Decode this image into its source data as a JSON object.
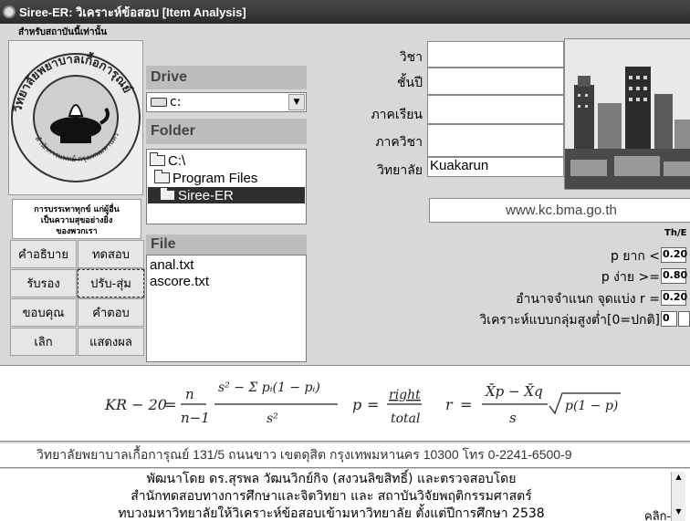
{
  "window": {
    "title": "Siree-ER: วิเคราะห์ข้อสอบ [Item Analysis]"
  },
  "logo": {
    "note": "สำหรับสถาบันนี้เท่านั้น",
    "ring_text": "วิทยาลัยพยาบาลเกื้อการุณย์",
    "bottom_text": "สำนักการแพทย์ กรุงเทพมหานคร"
  },
  "motto": [
    "การบรรเทาทุกข์ แก่ผู้อื่น",
    "เป็นความสุขอย่างยิ่ง",
    "ของพวกเรา"
  ],
  "buttons": {
    "explain": "คำอธิบาย",
    "test": "ทดสอบ",
    "certify": "รับรอง",
    "adjust": "ปรับ-สุ่ม",
    "thanks": "ขอบคุณ",
    "answer": "คำตอบ",
    "quit": "เลิก",
    "show": "แสดงผล"
  },
  "drive": {
    "header": "Drive",
    "value": "c:"
  },
  "folder": {
    "header": "Folder",
    "items": [
      "C:\\",
      "Program Files",
      "Siree-ER"
    ],
    "selected": "Siree-ER"
  },
  "file": {
    "header": "File",
    "items": [
      "anal.txt",
      "ascore.txt"
    ]
  },
  "form": {
    "subject_label": "วิชา",
    "subject_value": "",
    "year_label": "ชั้นปี",
    "year_value": "",
    "term_label": "ภาคเรียน",
    "term_value": "",
    "dept_label": "ภาควิชา",
    "dept_value": "",
    "college_label": "วิทยาลัย",
    "college_value": "Kuakarun",
    "website": "www.kc.bma.go.th"
  },
  "params": {
    "lang_label": "Th/E",
    "hard_label": "p ยาก  <",
    "hard_value": "0.20",
    "easy_label": "p ง่าย >=",
    "easy_value": "0.80",
    "disc_label": "อำนาจจำแนก จุดแบ่ง r =",
    "disc_value": "0.20",
    "group_label": "วิเคราะห์แบบกลุ่มสูงต่ำ[0=ปกติ]",
    "group_value": "0"
  },
  "formula": {
    "kr_label": "KR − 20",
    "n": "n",
    "n_minus_1": "n−1",
    "kr_num": "s² − Σ pᵢ(1 − pᵢ)",
    "s2": "s²",
    "p_label": "p",
    "right": "right",
    "total": "total",
    "r_label": "r",
    "r_num": "X̄p − X̄q",
    "s": "s",
    "sqrt": "p(1 − p)"
  },
  "address": "วิทยาลัยพยาบาลเกื้อการุณย์ 131/5 ถนนขาว เขตดุสิต กรุงเทพมหานคร 10300 โทร 0-2241-6500-9",
  "credits": [
    "พัฒนาโดย ดร.สุรพล วัฒนวิกย์กิจ (สงวนลิขสิทธิ์) และตรวจสอบโดย",
    "สำนักทดสอบทางการศึกษาและจิตวิทยา  และ  สถาบันวิจัยพฤติกรรมศาสตร์",
    "ทบวงมหาวิทยาลัยให้วิเคราะห์ข้อสอบเข้ามหาวิทยาลัย ตั้งแต่ปีการศึกษา 2538"
  ],
  "click_more": "คลิก-"
}
